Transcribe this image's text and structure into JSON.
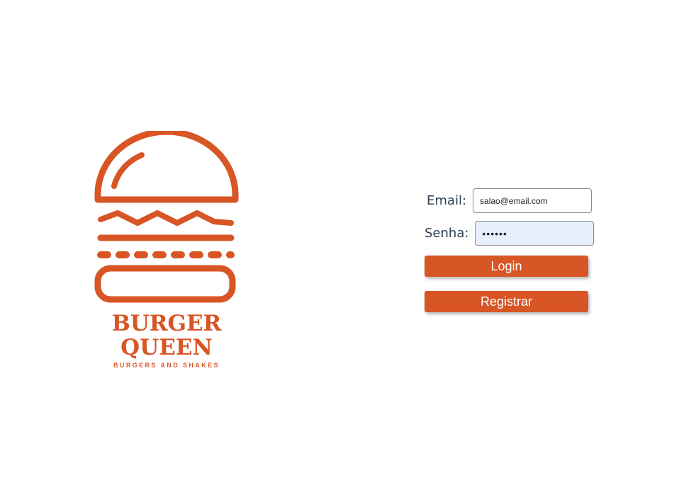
{
  "brand": {
    "name_line1": "BURGER",
    "name_line2": "QUEEN",
    "tagline": "BURGERS AND SHAKES",
    "color": "#d85525",
    "icon": "burger-icon"
  },
  "form": {
    "email": {
      "label": "Email:",
      "value": "salao@email.com"
    },
    "password": {
      "label": "Senha:",
      "value": "••••••"
    },
    "login_label": "Login",
    "register_label": "Registrar"
  }
}
